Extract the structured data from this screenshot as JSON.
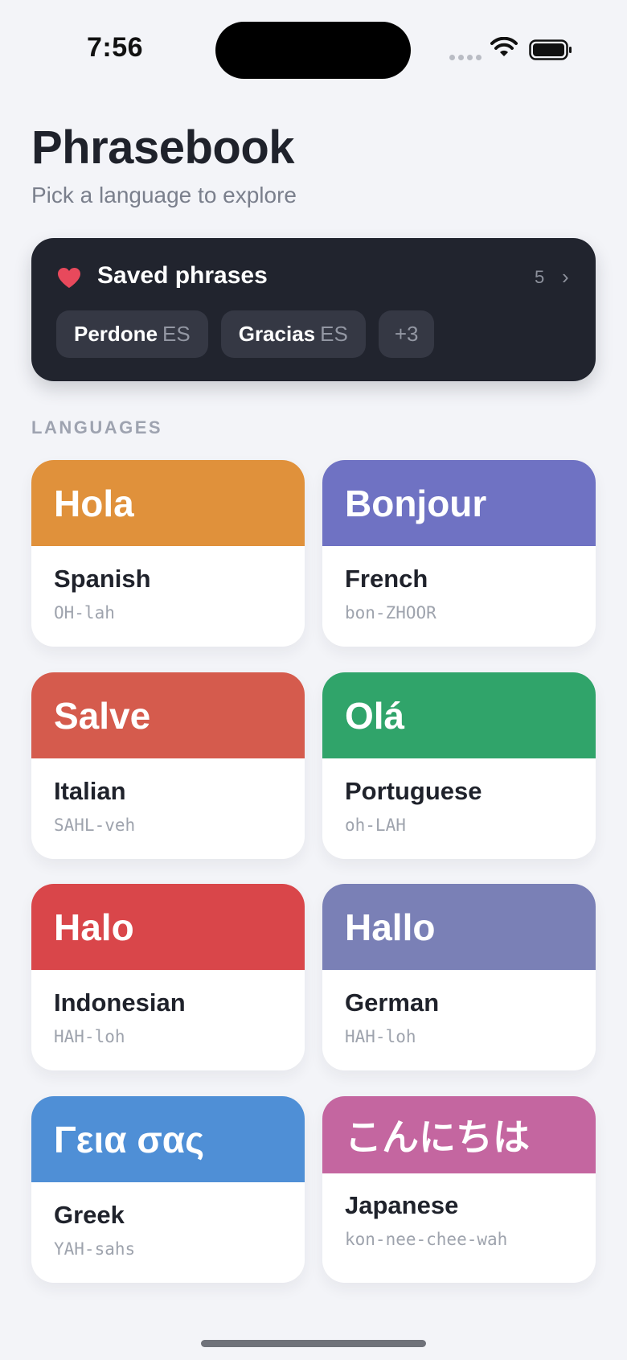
{
  "status_bar": {
    "time": "7:56"
  },
  "header": {
    "title": "Phrasebook",
    "subtitle": "Pick a language to explore"
  },
  "saved": {
    "title": "Saved phrases",
    "count": "5",
    "chevron": "›",
    "chips": [
      {
        "phrase": "Perdone",
        "lang": "ES"
      },
      {
        "phrase": "Gracias",
        "lang": "ES"
      }
    ],
    "more": "+3",
    "heart_color": "#e8495c"
  },
  "section_label": "LANGUAGES",
  "languages": [
    {
      "greeting": "Hola",
      "name": "Spanish",
      "pronunciation": "OH-lah",
      "color": "#e0913b"
    },
    {
      "greeting": "Bonjour",
      "name": "French",
      "pronunciation": "bon-ZHOOR",
      "color": "#6f72c3"
    },
    {
      "greeting": "Salve",
      "name": "Italian",
      "pronunciation": "SAHL-veh",
      "color": "#d55b4d"
    },
    {
      "greeting": "Olá",
      "name": "Portuguese",
      "pronunciation": "oh-LAH",
      "color": "#30a46a"
    },
    {
      "greeting": "Halo",
      "name": "Indonesian",
      "pronunciation": "HAH-loh",
      "color": "#d9464a"
    },
    {
      "greeting": "Hallo",
      "name": "German",
      "pronunciation": "HAH-loh",
      "color": "#7a80b6"
    },
    {
      "greeting": "Γεια σας",
      "name": "Greek",
      "pronunciation": "YAH-sahs",
      "color": "#4f8fd6"
    },
    {
      "greeting": "こんにちは",
      "name": "Japanese",
      "pronunciation": "kon-nee-chee-wah",
      "color": "#c466a0"
    }
  ]
}
